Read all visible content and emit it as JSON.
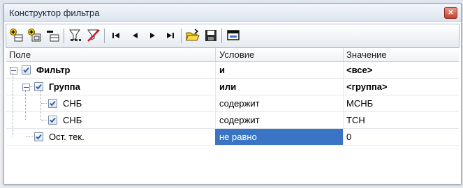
{
  "window": {
    "title": "Конструктор фильтра"
  },
  "columns": {
    "field": "Поле",
    "condition": "Условие",
    "value": "Значение"
  },
  "rows": [
    {
      "field": "Фильтр",
      "condition": "и",
      "value": "<все>",
      "checked": true,
      "bold": true,
      "level": 0,
      "expander": true
    },
    {
      "field": "Группа",
      "condition": "или",
      "value": "<группа>",
      "checked": true,
      "bold": true,
      "level": 1,
      "expander": true
    },
    {
      "field": "СНБ",
      "condition": "содержит",
      "value": "МСНБ",
      "checked": true,
      "bold": false,
      "level": 2,
      "expander": false
    },
    {
      "field": "СНБ",
      "condition": "содержит",
      "value": "ТСН",
      "checked": true,
      "bold": false,
      "level": 2,
      "expander": false
    },
    {
      "field": "Ост. тек.",
      "condition": "не равно",
      "value": "0",
      "checked": true,
      "bold": false,
      "level": 1,
      "expander": false,
      "selected_cell": "condition"
    }
  ],
  "toolbar": {
    "buttons": [
      "add-condition-icon",
      "add-group-icon",
      "delete-row-icon",
      "filter-icon",
      "clear-filter-icon",
      "first-icon",
      "prev-icon",
      "next-icon",
      "last-icon",
      "open-icon",
      "save-icon",
      "apply-icon"
    ]
  },
  "colors": {
    "selection": "#3a74c4",
    "check": "#2a5fb0",
    "title_bar": "#dbe4ef"
  }
}
